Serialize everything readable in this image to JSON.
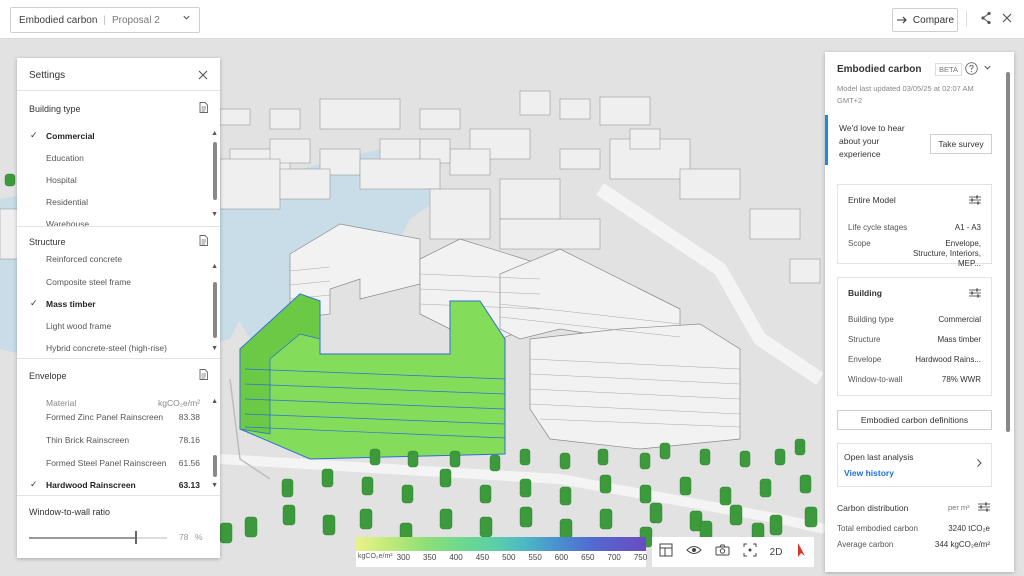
{
  "topbar": {
    "app_title": "Embodied carbon",
    "proposal": "Proposal 2",
    "compare_label": "Compare"
  },
  "settings": {
    "title": "Settings",
    "building_type": {
      "title": "Building type",
      "options": [
        "Commercial",
        "Education",
        "Hospital",
        "Residential",
        "Warehouse"
      ],
      "selected": "Commercial"
    },
    "structure": {
      "title": "Structure",
      "options": [
        "Reinforced concrete",
        "Composite steel frame",
        "Mass timber",
        "Light wood frame",
        "Hybrid concrete-steel (high-rise)"
      ],
      "selected": "Mass timber"
    },
    "envelope": {
      "title": "Envelope",
      "col_material": "Material",
      "col_unit": "kgCO₂e/m²",
      "rows": [
        {
          "name": "Formed Zinc Panel Rainscreen",
          "value": "83.38"
        },
        {
          "name": "Thin Brick Rainscreen",
          "value": "78.16"
        },
        {
          "name": "Formed Steel Panel Rainscreen",
          "value": "61.56"
        },
        {
          "name": "Hardwood Rainscreen",
          "value": "63.13"
        }
      ],
      "selected": "Hardwood Rainscreen"
    },
    "wwr": {
      "title": "Window-to-wall ratio",
      "value": "78",
      "unit": "%",
      "fraction": 0.78
    }
  },
  "panel": {
    "title": "Embodied carbon",
    "beta": "BETA",
    "updated": "Model last updated 03/05/25 at 02:07 AM GMT+2",
    "survey_text": "We'd love to hear about your experience",
    "survey_button": "Take survey",
    "entire_model": {
      "title": "Entire Model",
      "rows": [
        {
          "k": "Life cycle stages",
          "v": "A1 - A3"
        },
        {
          "k": "Scope",
          "v": "Envelope, Structure, Interiors, MEP..."
        }
      ]
    },
    "building": {
      "title": "Building",
      "rows": [
        {
          "k": "Building type",
          "v": "Commercial"
        },
        {
          "k": "Structure",
          "v": "Mass timber"
        },
        {
          "k": "Envelope",
          "v": "Hardwood Rains..."
        },
        {
          "k": "Window-to-wall",
          "v": "78% WWR"
        }
      ]
    },
    "definitions_button": "Embodied carbon definitions",
    "open_last": "Open last analysis",
    "view_history": "View history",
    "carbon_distribution": "Carbon distribution",
    "per_unit": "per m²",
    "total_label": "Total embodied carbon",
    "total_value": "3240 tCO₂e",
    "average_label": "Average carbon",
    "average_value": "344 kgCO₂e/m²"
  },
  "legend": {
    "unit": "kgCO₂e/m²",
    "ticks": [
      "300",
      "350",
      "400",
      "450",
      "500",
      "550",
      "600",
      "650",
      "700",
      "750"
    ]
  },
  "toolbar": {
    "icons": [
      "layout-icon",
      "eye-icon",
      "camera-icon",
      "focus-icon",
      "2d-toggle",
      "compass-icon"
    ],
    "twod_label": "2D"
  },
  "colors": {
    "accent": "#1e6fd9",
    "highlight_building": "#7ed957",
    "water": "#c9dde8",
    "tree": "#3c9a3c"
  }
}
